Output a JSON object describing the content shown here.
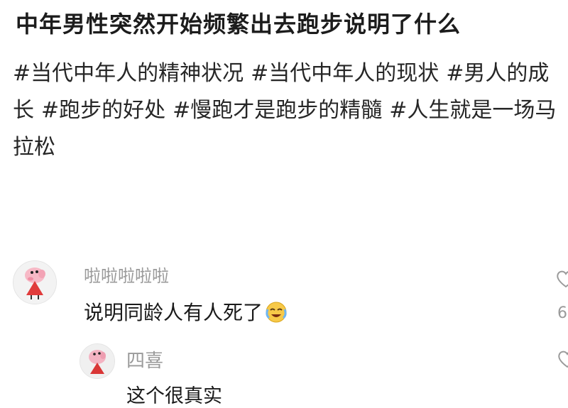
{
  "post": {
    "title": "中年男性突然开始频繁出去跑步说明了什么",
    "hashtags": [
      "#当代中年人的精神状况",
      "#当代中年人的现状",
      "#男人的成长",
      "#跑步的好处",
      "#慢跑才是跑步的精髓",
      "#人生就是一场马拉松"
    ]
  },
  "comments": [
    {
      "username": "啦啦啦啦啦",
      "text": "说明同龄人有人死了",
      "emoji": "crying-laughing-emoji",
      "likes": "6"
    },
    {
      "username": "四喜",
      "text": "这个很真实"
    }
  ],
  "icons": {
    "like": "heart-outline-icon",
    "avatar1": "peppa-pig-avatar",
    "avatar2": "peppa-pig-avatar"
  }
}
